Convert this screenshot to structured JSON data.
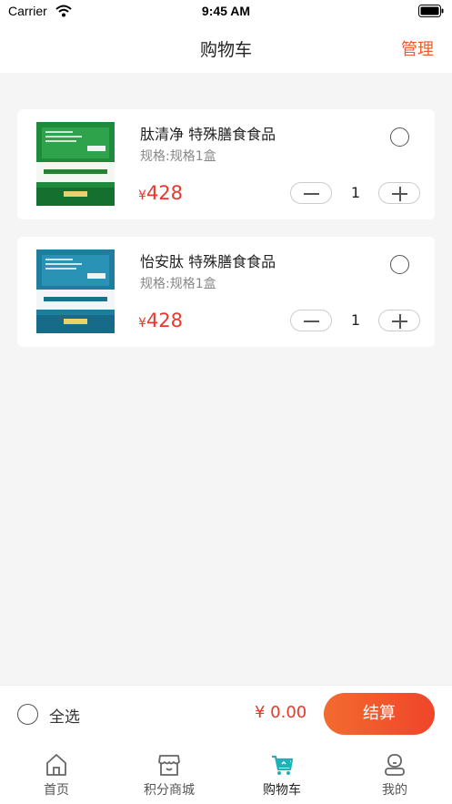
{
  "status_bar": {
    "carrier": "Carrier",
    "time": "9:45 AM"
  },
  "nav": {
    "title": "购物车",
    "manage": "管理"
  },
  "cart": {
    "items": [
      {
        "name": "肽清净 特殊膳食食品",
        "spec": "规格:规格1盒",
        "currency": "¥",
        "price": "428",
        "quantity": "1",
        "box_color": "#1e8a3c",
        "box_label": "肽清净 特殊膳食食品",
        "selected": false
      },
      {
        "name": "怡安肽 特殊膳食食品",
        "spec": "规格:规格1盒",
        "currency": "¥",
        "price": "428",
        "quantity": "1",
        "box_color": "#1f7ea0",
        "box_label": "怡安肽 特殊膳食食品",
        "selected": false
      }
    ]
  },
  "footer": {
    "select_all": "全选",
    "total": "¥ 0.00",
    "checkout": "结算"
  },
  "tabs": [
    {
      "label": "首页",
      "icon": "home-icon"
    },
    {
      "label": "积分商城",
      "icon": "store-icon"
    },
    {
      "label": "购物车",
      "icon": "cart-icon",
      "active": true
    },
    {
      "label": "我的",
      "icon": "profile-icon"
    }
  ],
  "colors": {
    "accent": "#f05a28",
    "price": "#e8382c",
    "active_tab": "#22b0b8"
  }
}
